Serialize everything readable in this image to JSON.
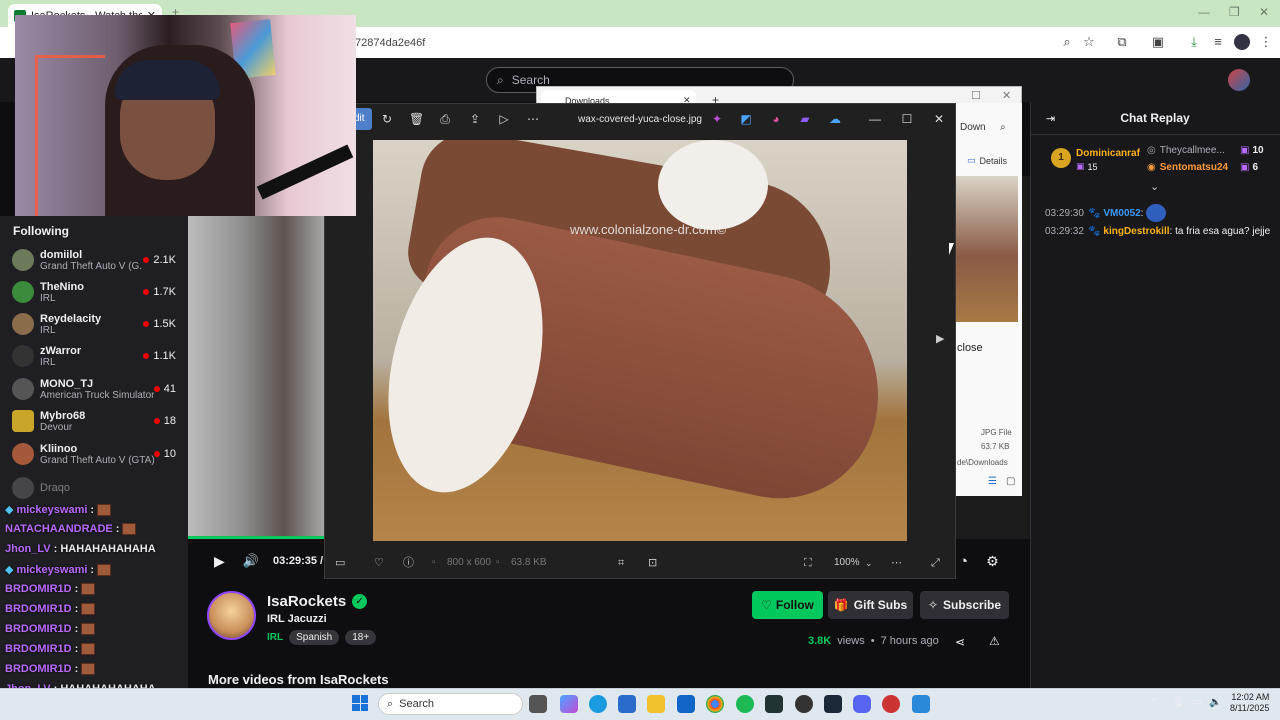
{
  "browser": {
    "tab_title": "IsaRockets - Watch the VOD o...",
    "url_fragment": "72874da2e46f"
  },
  "site": {
    "search_placeholder": "Search"
  },
  "following": {
    "heading": "Following",
    "items": [
      {
        "name": "domiilol",
        "game": "Grand Theft Auto V (G...",
        "viewers": "2.1K"
      },
      {
        "name": "TheNino",
        "game": "IRL",
        "viewers": "1.7K"
      },
      {
        "name": "Reydelacity",
        "game": "IRL",
        "viewers": "1.5K"
      },
      {
        "name": "zWarror",
        "game": "IRL",
        "viewers": "1.1K"
      },
      {
        "name": "MONO_TJ",
        "game": "American Truck Simulator",
        "viewers": "41"
      },
      {
        "name": "Mybro68",
        "game": "Devour",
        "viewers": "18"
      },
      {
        "name": "Kliinoo",
        "game": "Grand Theft Auto V (GTA)",
        "viewers": "10"
      },
      {
        "name": "Draqo",
        "game": "",
        "viewers": ""
      }
    ]
  },
  "overlay_chat": [
    {
      "user": "mickeyswami",
      "text": ":"
    },
    {
      "user": "NATACHAANDRADE",
      "text": ":"
    },
    {
      "user": "Jhon_LV",
      "text": ": HAHAHAHAHAHA"
    },
    {
      "user": "mickeyswami",
      "text": ":"
    },
    {
      "user": "BRDOMIR1D",
      "text": ":"
    },
    {
      "user": "BRDOMIR1D",
      "text": ":"
    },
    {
      "user": "BRDOMIR1D",
      "text": ":"
    },
    {
      "user": "BRDOMIR1D",
      "text": ":"
    },
    {
      "user": "BRDOMIR1D",
      "text": ":"
    },
    {
      "user": "Jhon_LV",
      "text": ": HAHAHAHAHAHA"
    }
  ],
  "player": {
    "time": "03:29:35 /",
    "progress": 1.0
  },
  "photos": {
    "filename": "wax-covered-yuca-close.jpg",
    "edit_label": "dit",
    "dimensions": "800 x 600",
    "filesize": "63.8 KB",
    "zoom": "100%",
    "watermark": "www.colonialzone-dr.com©"
  },
  "explorer": {
    "tab_title": "Downloads",
    "sort_label": "Down",
    "details_label": "Details",
    "item_label": "close",
    "file_type": "JPG File",
    "file_size": "63.7 KB",
    "file_path": "de\\Downloads"
  },
  "chat": {
    "title": "Chat Replay",
    "gifters": [
      {
        "rank": "1",
        "name": "Dominicanraf",
        "count": "15"
      },
      {
        "name": "Theycallmee...",
        "count": "10"
      },
      {
        "name": "Sentomatsu24",
        "count": "6"
      }
    ],
    "messages": [
      {
        "time": "03:29:30",
        "user": "VM0052",
        "text": ":"
      },
      {
        "time": "03:29:32",
        "user": "kingDestrokill",
        "text": ": ta fria esa agua? jejje"
      }
    ]
  },
  "channel": {
    "name": "IsaRockets",
    "stream_title": "IRL Jacuzzi",
    "category": "IRL",
    "tags": [
      "Spanish",
      "18+"
    ],
    "follow_label": "Follow",
    "gift_label": "Gift Subs",
    "subscribe_label": "Subscribe",
    "views": "3.8K",
    "views_label": "views",
    "ago": "7 hours ago",
    "more_heading": "More videos from IsaRockets"
  },
  "taskbar": {
    "search_label": "Search",
    "time": "12:02 AM",
    "date": "8/11/2025"
  },
  "colors": {
    "accent_green": "#00c85c",
    "live_red": "#eb0400",
    "bg": "#0e0e10"
  }
}
